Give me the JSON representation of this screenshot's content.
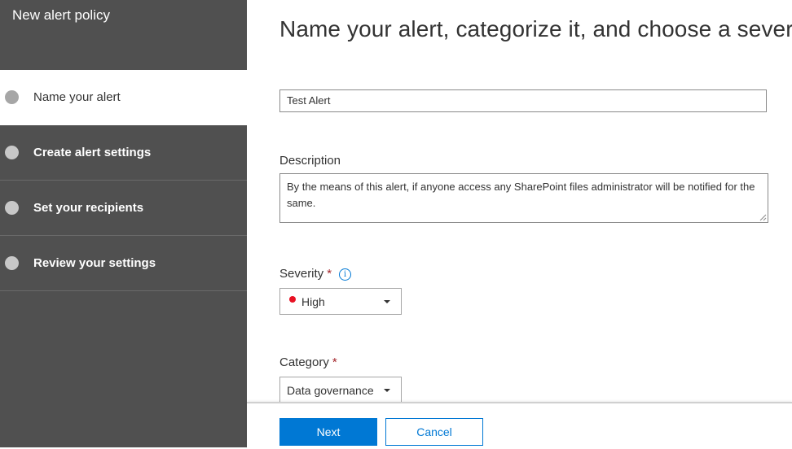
{
  "sidebar": {
    "title": "New alert policy",
    "steps": [
      {
        "label": "Name your alert",
        "active": true
      },
      {
        "label": "Create alert settings",
        "active": false
      },
      {
        "label": "Set your recipients",
        "active": false
      },
      {
        "label": "Review your settings",
        "active": false
      }
    ]
  },
  "main": {
    "heading": "Name your alert, categorize it, and choose a severity.",
    "name_value": "Test Alert",
    "description_label": "Description",
    "description_value": "By the means of this alert, if anyone access any SharePoint files administrator will be notified for the same.",
    "severity_label": "Severity",
    "required_marker": "*",
    "severity_value": "High",
    "severity_color": "#e81123",
    "category_label": "Category",
    "category_value": "Data governance",
    "info_icon": "info-icon"
  },
  "footer": {
    "next_label": "Next",
    "cancel_label": "Cancel"
  },
  "colors": {
    "sidebar_bg": "#505050",
    "accent": "#0078d4",
    "required": "#a4262c"
  }
}
